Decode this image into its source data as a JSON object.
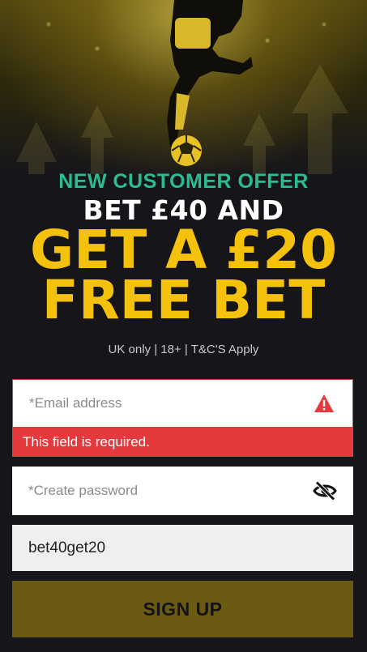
{
  "offer": {
    "subtitle": "NEW CUSTOMER OFFER",
    "line1": "BET £40 AND",
    "line2": "GET A £20",
    "line3": "FREE BET",
    "terms": "UK only | 18+ | T&C'S Apply"
  },
  "form": {
    "email": {
      "placeholder": "*Email address",
      "value": "",
      "error": "This field is required."
    },
    "password": {
      "placeholder": "*Create password",
      "value": ""
    },
    "promo": {
      "value": "bet40get20"
    },
    "submit_label": "SIGN UP"
  },
  "colors": {
    "accent_yellow": "#f4c20d",
    "accent_green": "#2bbd8e",
    "error_red": "#e43a3d",
    "button_bg": "#6a5a12",
    "background": "#16161a"
  },
  "icons": {
    "email_status": "warning-triangle-icon",
    "password_toggle": "eye-off-icon"
  }
}
